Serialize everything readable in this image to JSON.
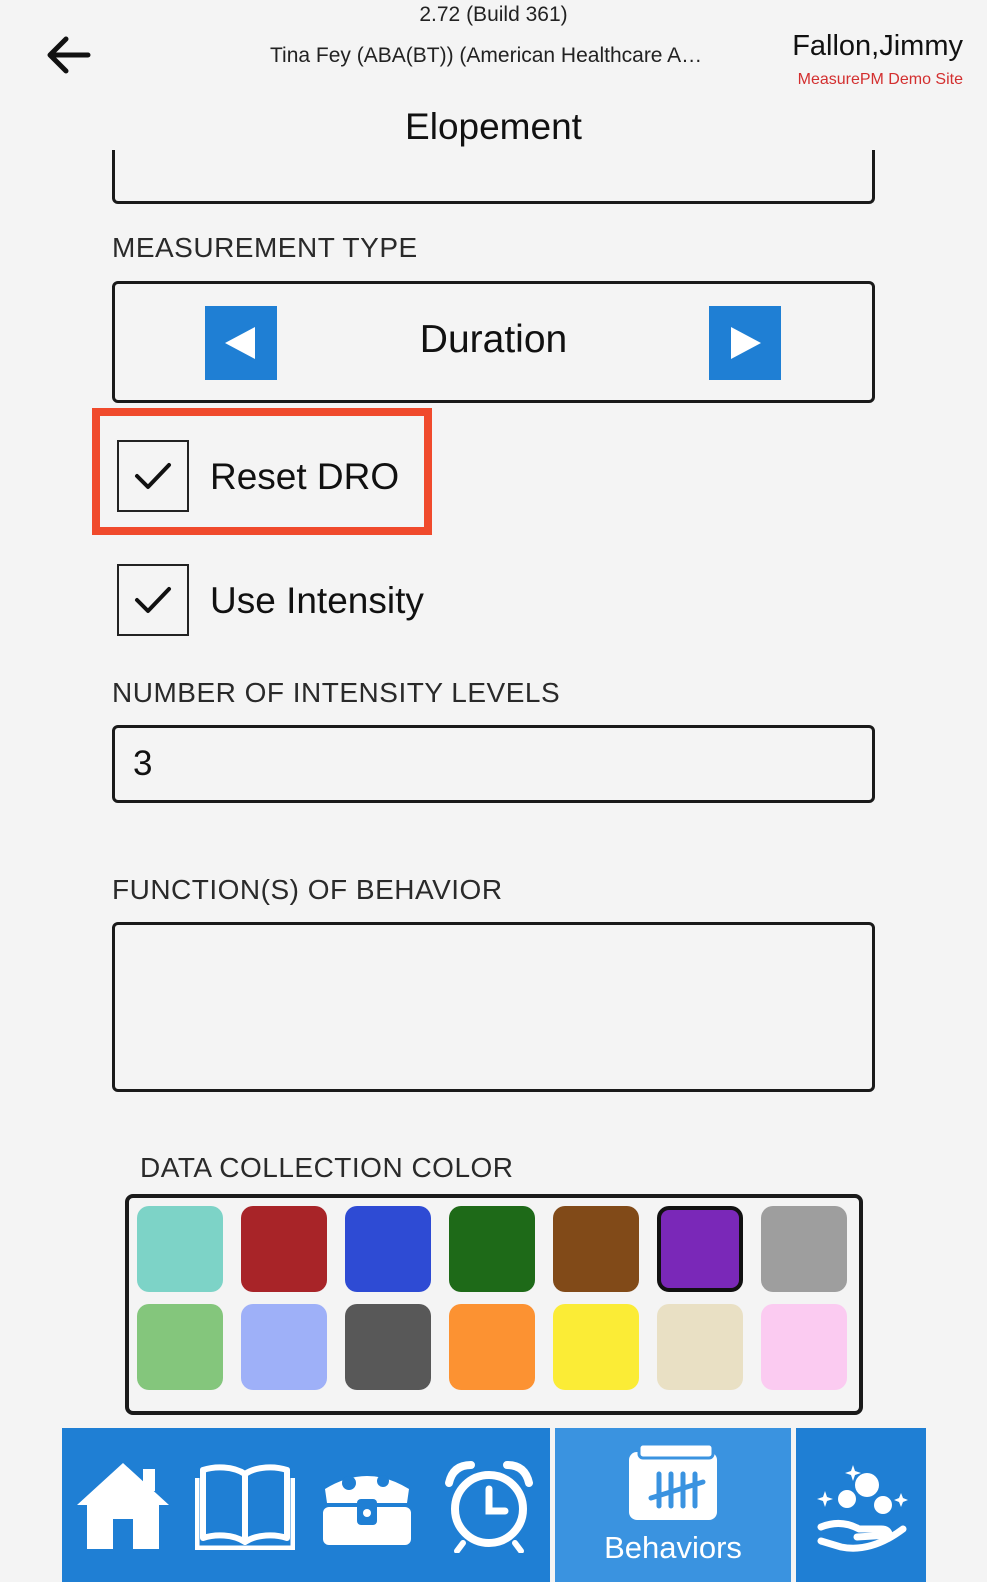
{
  "header": {
    "version": "2.72 (Build 361)",
    "provider": "Tina Fey (ABA(BT)) (American Healthcare Associates)",
    "user_name": "Fallon,Jimmy",
    "site": "MeasurePM Demo Site"
  },
  "page": {
    "title": "Elopement"
  },
  "measurement": {
    "label": "MEASUREMENT TYPE",
    "value": "Duration"
  },
  "checkboxes": {
    "reset_dro": {
      "label": "Reset DRO",
      "checked": true
    },
    "use_intensity": {
      "label": "Use Intensity",
      "checked": true
    }
  },
  "intensity": {
    "label": "NUMBER OF INTENSITY LEVELS",
    "value": "3"
  },
  "functions": {
    "label": "FUNCTION(S) OF BEHAVIOR",
    "value": ""
  },
  "colors": {
    "label": "DATA COLLECTION COLOR",
    "swatches": [
      "#7dd3c7",
      "#a82428",
      "#2e4bd4",
      "#1e6a18",
      "#814a18",
      "#7a28b8",
      "#9e9e9e",
      "#84c67c",
      "#9eb0f8",
      "#585858",
      "#fc9232",
      "#fbec36",
      "#e9e0c4",
      "#fbcbf1"
    ],
    "selected_index": 5
  },
  "nav": {
    "active_label": "Behaviors",
    "accent": "#1f7fd4"
  }
}
